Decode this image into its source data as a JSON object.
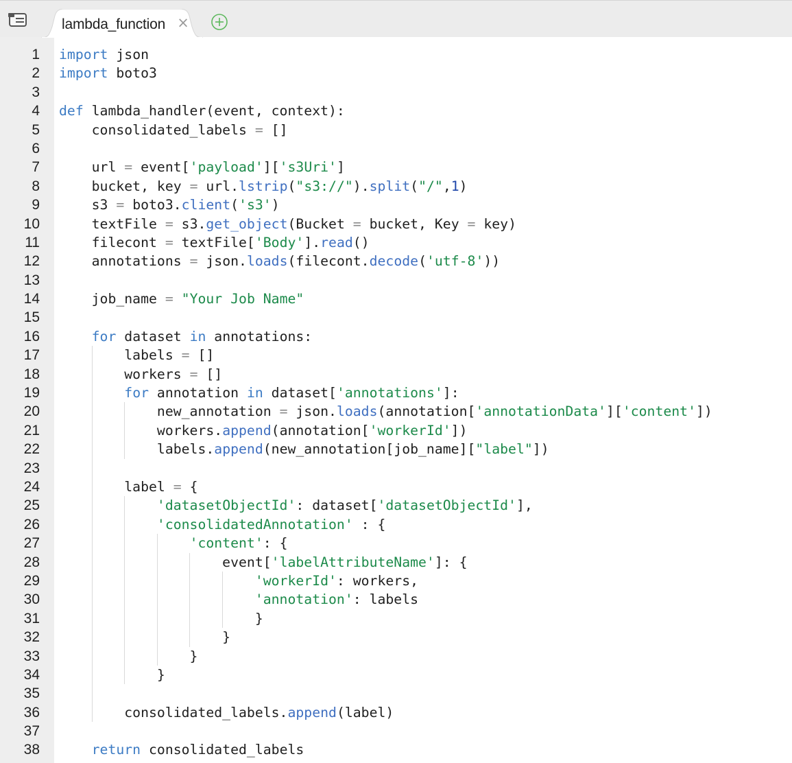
{
  "tab": {
    "label": "lambda_function",
    "close_glyph": "×",
    "icons": [
      "menu-icon",
      "close-icon",
      "add-tab-icon"
    ]
  },
  "colors": {
    "keyword": "#3c7bc4",
    "string": "#1c8a4a",
    "method": "#3f6fc0",
    "number": "#1c44a8",
    "operator": "#8a8a8a",
    "text": "#1f1f1f",
    "gutter": "#eeeeee",
    "add_icon": "#5cb85c"
  },
  "editor": {
    "lines": [
      {
        "number": "1",
        "indent": 0,
        "tokens": [
          [
            "kw",
            "import"
          ],
          [
            "id",
            " json"
          ]
        ]
      },
      {
        "number": "2",
        "indent": 0,
        "tokens": [
          [
            "kw",
            "import"
          ],
          [
            "id",
            " boto3"
          ]
        ]
      },
      {
        "number": "3",
        "indent": 0,
        "tokens": []
      },
      {
        "number": "4",
        "indent": 0,
        "tokens": [
          [
            "kw",
            "def"
          ],
          [
            "id",
            " lambda_handler(event, context):"
          ]
        ]
      },
      {
        "number": "5",
        "indent": 0,
        "tokens": [
          [
            "id",
            "    consolidated_labels "
          ],
          [
            "op",
            "="
          ],
          [
            "id",
            " []"
          ]
        ]
      },
      {
        "number": "6",
        "indent": 0,
        "tokens": []
      },
      {
        "number": "7",
        "indent": 0,
        "tokens": [
          [
            "id",
            "    url "
          ],
          [
            "op",
            "="
          ],
          [
            "id",
            " event["
          ],
          [
            "str",
            "'payload'"
          ],
          [
            "id",
            "]["
          ],
          [
            "str",
            "'s3Uri'"
          ],
          [
            "id",
            "]"
          ]
        ]
      },
      {
        "number": "8",
        "indent": 0,
        "tokens": [
          [
            "id",
            "    bucket, key "
          ],
          [
            "op",
            "="
          ],
          [
            "id",
            " url."
          ],
          [
            "fn",
            "lstrip"
          ],
          [
            "id",
            "("
          ],
          [
            "str",
            "\"s3://\""
          ],
          [
            "id",
            ")."
          ],
          [
            "fn",
            "split"
          ],
          [
            "id",
            "("
          ],
          [
            "str",
            "\"/\""
          ],
          [
            "id",
            ","
          ],
          [
            "num",
            "1"
          ],
          [
            "id",
            ")"
          ]
        ]
      },
      {
        "number": "9",
        "indent": 0,
        "tokens": [
          [
            "id",
            "    s3 "
          ],
          [
            "op",
            "="
          ],
          [
            "id",
            " boto3."
          ],
          [
            "fn",
            "client"
          ],
          [
            "id",
            "("
          ],
          [
            "str",
            "'s3'"
          ],
          [
            "id",
            ")"
          ]
        ]
      },
      {
        "number": "10",
        "indent": 0,
        "tokens": [
          [
            "id",
            "    textFile "
          ],
          [
            "op",
            "="
          ],
          [
            "id",
            " s3."
          ],
          [
            "fn",
            "get_object"
          ],
          [
            "id",
            "(Bucket "
          ],
          [
            "op",
            "="
          ],
          [
            "id",
            " bucket, Key "
          ],
          [
            "op",
            "="
          ],
          [
            "id",
            " key)"
          ]
        ]
      },
      {
        "number": "11",
        "indent": 0,
        "tokens": [
          [
            "id",
            "    filecont "
          ],
          [
            "op",
            "="
          ],
          [
            "id",
            " textFile["
          ],
          [
            "str",
            "'Body'"
          ],
          [
            "id",
            "]."
          ],
          [
            "fn",
            "read"
          ],
          [
            "id",
            "()"
          ]
        ]
      },
      {
        "number": "12",
        "indent": 0,
        "tokens": [
          [
            "id",
            "    annotations "
          ],
          [
            "op",
            "="
          ],
          [
            "id",
            " json."
          ],
          [
            "fn",
            "loads"
          ],
          [
            "id",
            "(filecont."
          ],
          [
            "fn",
            "decode"
          ],
          [
            "id",
            "("
          ],
          [
            "str",
            "'utf-8'"
          ],
          [
            "id",
            "))"
          ]
        ]
      },
      {
        "number": "13",
        "indent": 0,
        "tokens": []
      },
      {
        "number": "14",
        "indent": 0,
        "tokens": [
          [
            "id",
            "    job_name "
          ],
          [
            "op",
            "="
          ],
          [
            "id",
            " "
          ],
          [
            "str",
            "\"Your Job Name\""
          ]
        ]
      },
      {
        "number": "15",
        "indent": 0,
        "tokens": []
      },
      {
        "number": "16",
        "indent": 0,
        "tokens": [
          [
            "id",
            "    "
          ],
          [
            "kw",
            "for"
          ],
          [
            "id",
            " dataset "
          ],
          [
            "kw",
            "in"
          ],
          [
            "id",
            " annotations:"
          ]
        ]
      },
      {
        "number": "17",
        "indent": 1,
        "tokens": [
          [
            "id",
            "        labels "
          ],
          [
            "op",
            "="
          ],
          [
            "id",
            " []"
          ]
        ]
      },
      {
        "number": "18",
        "indent": 1,
        "tokens": [
          [
            "id",
            "        workers "
          ],
          [
            "op",
            "="
          ],
          [
            "id",
            " []"
          ]
        ]
      },
      {
        "number": "19",
        "indent": 1,
        "tokens": [
          [
            "id",
            "        "
          ],
          [
            "kw",
            "for"
          ],
          [
            "id",
            " annotation "
          ],
          [
            "kw",
            "in"
          ],
          [
            "id",
            " dataset["
          ],
          [
            "str",
            "'annotations'"
          ],
          [
            "id",
            "]:"
          ]
        ]
      },
      {
        "number": "20",
        "indent": 2,
        "tokens": [
          [
            "id",
            "            new_annotation "
          ],
          [
            "op",
            "="
          ],
          [
            "id",
            " json."
          ],
          [
            "fn",
            "loads"
          ],
          [
            "id",
            "(annotation["
          ],
          [
            "str",
            "'annotationData'"
          ],
          [
            "id",
            "]["
          ],
          [
            "str",
            "'content'"
          ],
          [
            "id",
            "])"
          ]
        ]
      },
      {
        "number": "21",
        "indent": 2,
        "tokens": [
          [
            "id",
            "            workers."
          ],
          [
            "fn",
            "append"
          ],
          [
            "id",
            "(annotation["
          ],
          [
            "str",
            "'workerId'"
          ],
          [
            "id",
            "])"
          ]
        ]
      },
      {
        "number": "22",
        "indent": 2,
        "tokens": [
          [
            "id",
            "            labels."
          ],
          [
            "fn",
            "append"
          ],
          [
            "id",
            "(new_annotation[job_name]["
          ],
          [
            "str",
            "\"label\""
          ],
          [
            "id",
            "])"
          ]
        ]
      },
      {
        "number": "23",
        "indent": 1,
        "tokens": []
      },
      {
        "number": "24",
        "indent": 1,
        "tokens": [
          [
            "id",
            "        label "
          ],
          [
            "op",
            "="
          ],
          [
            "id",
            " {"
          ]
        ]
      },
      {
        "number": "25",
        "indent": 2,
        "tokens": [
          [
            "id",
            "            "
          ],
          [
            "str",
            "'datasetObjectId'"
          ],
          [
            "id",
            ": dataset["
          ],
          [
            "str",
            "'datasetObjectId'"
          ],
          [
            "id",
            "],"
          ]
        ]
      },
      {
        "number": "26",
        "indent": 2,
        "tokens": [
          [
            "id",
            "            "
          ],
          [
            "str",
            "'consolidatedAnnotation'"
          ],
          [
            "id",
            " : {"
          ]
        ]
      },
      {
        "number": "27",
        "indent": 3,
        "tokens": [
          [
            "id",
            "                "
          ],
          [
            "str",
            "'content'"
          ],
          [
            "id",
            ": {"
          ]
        ]
      },
      {
        "number": "28",
        "indent": 4,
        "tokens": [
          [
            "id",
            "                    event["
          ],
          [
            "str",
            "'labelAttributeName'"
          ],
          [
            "id",
            "]: {"
          ]
        ]
      },
      {
        "number": "29",
        "indent": 5,
        "tokens": [
          [
            "id",
            "                        "
          ],
          [
            "str",
            "'workerId'"
          ],
          [
            "id",
            ": workers,"
          ]
        ]
      },
      {
        "number": "30",
        "indent": 5,
        "tokens": [
          [
            "id",
            "                        "
          ],
          [
            "str",
            "'annotation'"
          ],
          [
            "id",
            ": labels"
          ]
        ]
      },
      {
        "number": "31",
        "indent": 5,
        "tokens": [
          [
            "id",
            "                        }"
          ]
        ]
      },
      {
        "number": "32",
        "indent": 4,
        "tokens": [
          [
            "id",
            "                    }"
          ]
        ]
      },
      {
        "number": "33",
        "indent": 3,
        "tokens": [
          [
            "id",
            "                }"
          ]
        ]
      },
      {
        "number": "34",
        "indent": 2,
        "tokens": [
          [
            "id",
            "            }"
          ]
        ]
      },
      {
        "number": "35",
        "indent": 1,
        "tokens": []
      },
      {
        "number": "36",
        "indent": 1,
        "tokens": [
          [
            "id",
            "        consolidated_labels."
          ],
          [
            "fn",
            "append"
          ],
          [
            "id",
            "(label)"
          ]
        ]
      },
      {
        "number": "37",
        "indent": 0,
        "tokens": []
      },
      {
        "number": "38",
        "indent": 0,
        "tokens": [
          [
            "id",
            "    "
          ],
          [
            "kw",
            "return"
          ],
          [
            "id",
            " consolidated_labels"
          ]
        ]
      }
    ]
  }
}
